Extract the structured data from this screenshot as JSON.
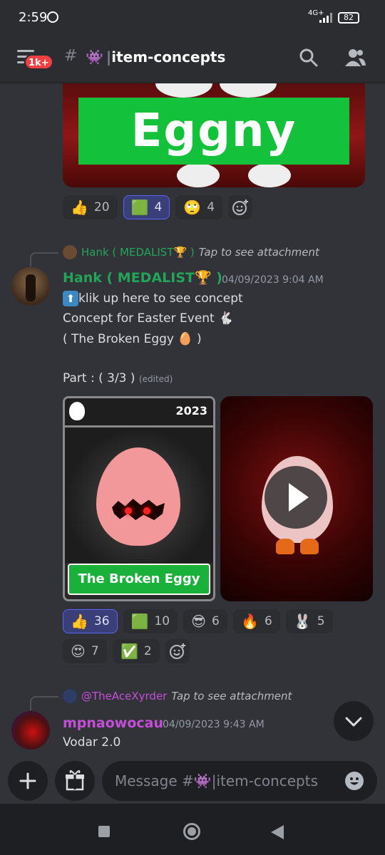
{
  "status_bar": {
    "time": "2:59",
    "network": "4G+",
    "battery": "82"
  },
  "header": {
    "badge": "1k+",
    "channel_emoji": "👾",
    "channel_name": "item-concepts"
  },
  "eggny_post": {
    "banner_text": "Eggny",
    "reactions": [
      {
        "emoji": "👍",
        "count": "20",
        "active": false
      },
      {
        "emoji": "🟩",
        "count": "4",
        "active": true
      },
      {
        "emoji": "🙄",
        "count": "4",
        "active": false
      }
    ]
  },
  "hank_post": {
    "reply": {
      "author": "Hank ( MEDALIST🏆 )",
      "action": "Tap to see attachment"
    },
    "author": "Hank ( MEDALIST🏆 )",
    "timestamp": "04/09/2023 9:04 AM",
    "lines": [
      "klik up here to see concept",
      "Concept for Easter Event 🐇",
      "( The Broken Eggy 🥚 )",
      "Part : ( 3/3 )"
    ],
    "edited_label": "(edited)",
    "card": {
      "year": "2023",
      "label": "The Broken Eggy"
    },
    "reactions": [
      {
        "emoji": "👍",
        "count": "36",
        "active": true
      },
      {
        "emoji": "🟩",
        "count": "10",
        "active": false
      },
      {
        "emoji": "😎",
        "count": "6",
        "active": false
      },
      {
        "emoji": "🔥",
        "count": "6",
        "active": false
      },
      {
        "emoji": "🐰",
        "count": "5",
        "active": false
      },
      {
        "emoji": "😍",
        "count": "7",
        "active": false
      },
      {
        "emoji": "✅",
        "count": "2",
        "active": false
      }
    ]
  },
  "mp_post": {
    "reply": {
      "author": "@TheAceXyrder",
      "action": "Tap to see attachment"
    },
    "author": "mpnaowocau",
    "timestamp": "04/09/2023 9:43 AM",
    "text": "Vodar 2.0"
  },
  "composer": {
    "placeholder_prefix": "Message #",
    "placeholder_emoji": "👾",
    "placeholder_channel": "item-concepts"
  },
  "colors": {
    "background": "#313338",
    "accent": "#5865f2",
    "hank_color": "#23a559",
    "mp_color": "#c34fd6",
    "badge": "#f23f43"
  }
}
